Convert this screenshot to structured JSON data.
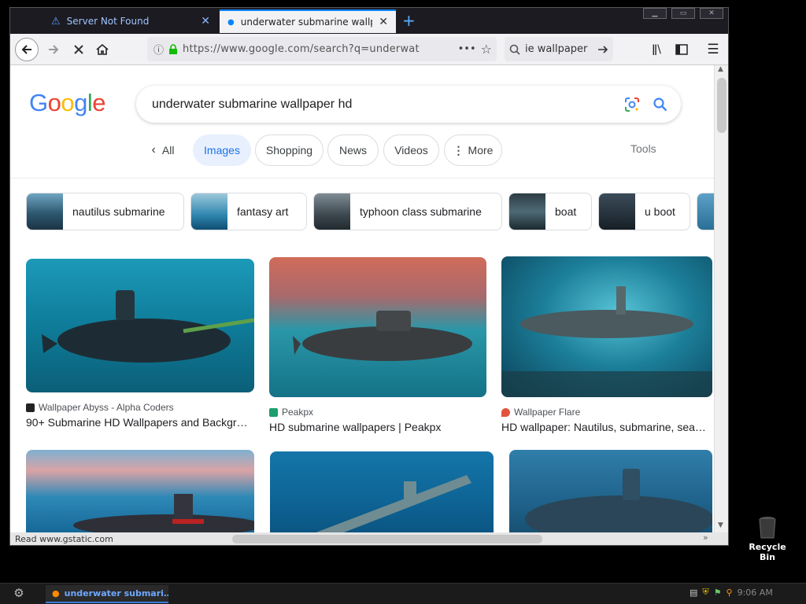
{
  "browser": {
    "tabs": [
      {
        "title": "Server Not Found",
        "active": false
      },
      {
        "title": "underwater submarine wallpa",
        "active": true
      }
    ],
    "new_tab": "+",
    "url": "https://www.google.com/search?q=underwat",
    "search_box": "ie wallpaper",
    "status": "Read www.gstatic.com"
  },
  "google": {
    "logo": "Google",
    "query": "underwater submarine wallpaper hd",
    "tabs": [
      {
        "label": "All",
        "active": false
      },
      {
        "label": "Images",
        "active": true
      },
      {
        "label": "Shopping",
        "active": false
      },
      {
        "label": "News",
        "active": false
      },
      {
        "label": "Videos",
        "active": false
      },
      {
        "label": "More",
        "active": false
      }
    ],
    "tools": "Tools",
    "related": [
      {
        "label": "nautilus submarine"
      },
      {
        "label": "fantasy art"
      },
      {
        "label": "typhoon class submarine"
      },
      {
        "label": "boat"
      },
      {
        "label": "u boot"
      }
    ],
    "results": [
      {
        "source": "Wallpaper Abyss - Alpha Coders",
        "title": "90+ Submarine HD Wallpapers and Backgr…"
      },
      {
        "source": "Peakpx",
        "title": "HD submarine wallpapers | Peakpx"
      },
      {
        "source": "Wallpaper Flare",
        "title": "HD wallpaper: Nautilus, submarine, sea…"
      }
    ]
  },
  "desktop": {
    "recycle_bin": "Recycle Bin",
    "taskbar_item": "underwater submari…",
    "clock": "9:06 AM"
  },
  "colors": {
    "google_blue": "#4285f4",
    "google_red": "#ea4335",
    "google_yellow": "#fbbc05",
    "google_green": "#34a853",
    "active_chip_bg": "#e8f0fe"
  }
}
